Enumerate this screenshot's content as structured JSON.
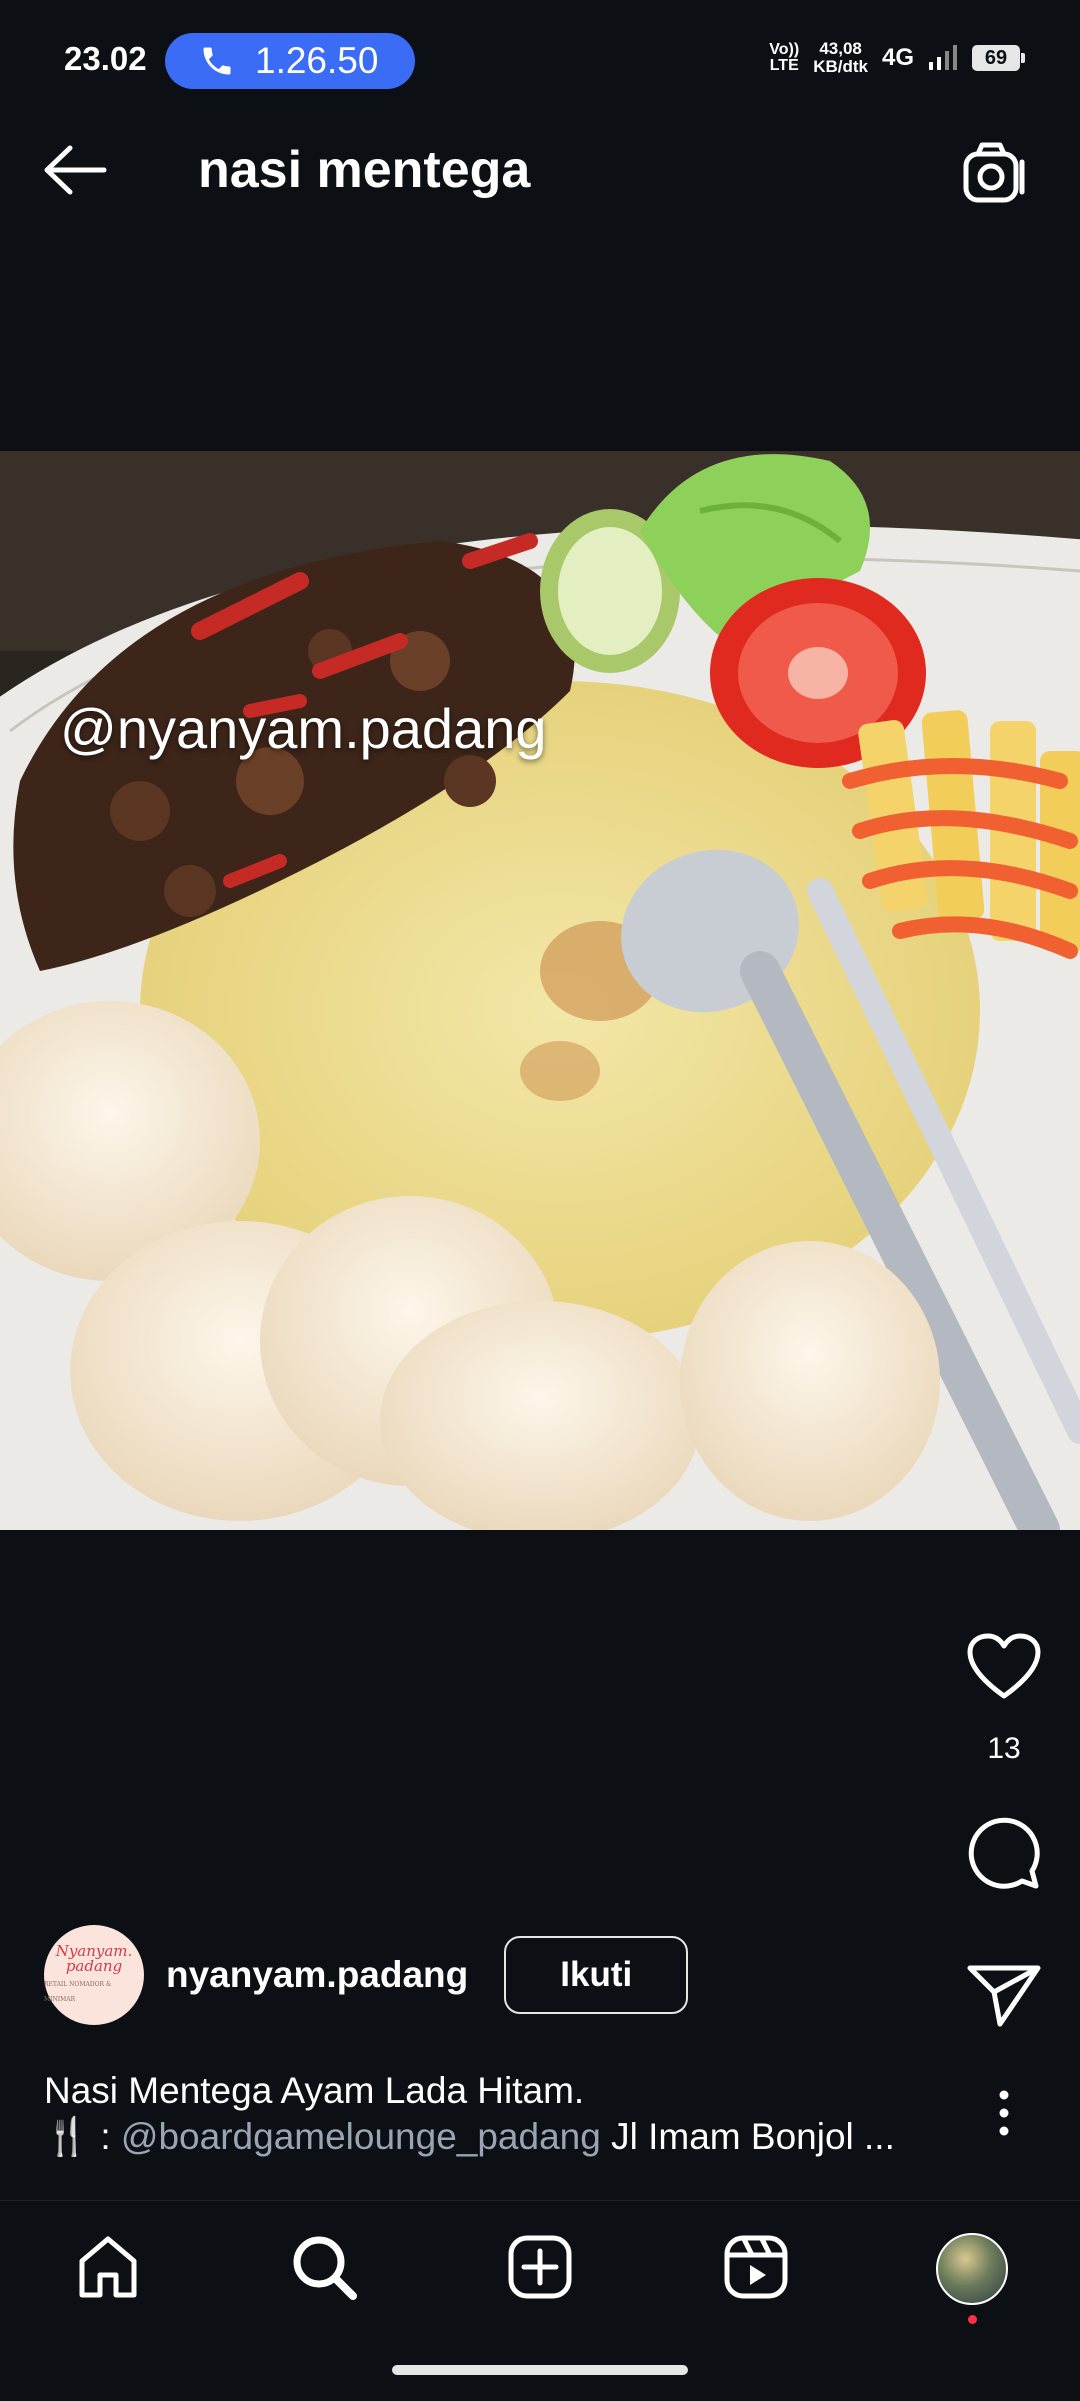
{
  "status_bar": {
    "time": "23.02",
    "call_timer": "1.26.50",
    "volte_top": "Vo))",
    "volte_bottom": "LTE",
    "net_speed_value": "43,08",
    "net_speed_unit": "KB/dtk",
    "network": "4G",
    "battery": "69"
  },
  "header": {
    "title": "nasi mentega"
  },
  "post": {
    "watermark": "@nyanyam.padang",
    "likes": "13",
    "author": {
      "username": "nyanyam.padang",
      "avatar_line1": "Nyanyam.",
      "avatar_line2": "padang",
      "avatar_line3": "RETAIL NOMADOR & MINIMAR",
      "follow_label": "Ikuti"
    },
    "caption": {
      "line1": "Nasi Mentega Ayam Lada Hitam.",
      "prefix": "🍴 : ",
      "mention": "@boardgamelounge_padang",
      "rest": " Jl Imam Bonjol ..."
    }
  },
  "icons": {
    "back": "back-arrow-icon",
    "camera": "camera-icon",
    "like": "heart-icon",
    "comment": "comment-icon",
    "share": "send-icon",
    "more": "more-vertical-icon",
    "home": "home-icon",
    "search": "search-icon",
    "add": "add-post-icon",
    "reels": "reels-icon"
  },
  "colors": {
    "background": "#0c0f14",
    "call_pill": "#3b6cf6",
    "mention": "#9aa4b2",
    "notification_dot": "#ff3040"
  }
}
